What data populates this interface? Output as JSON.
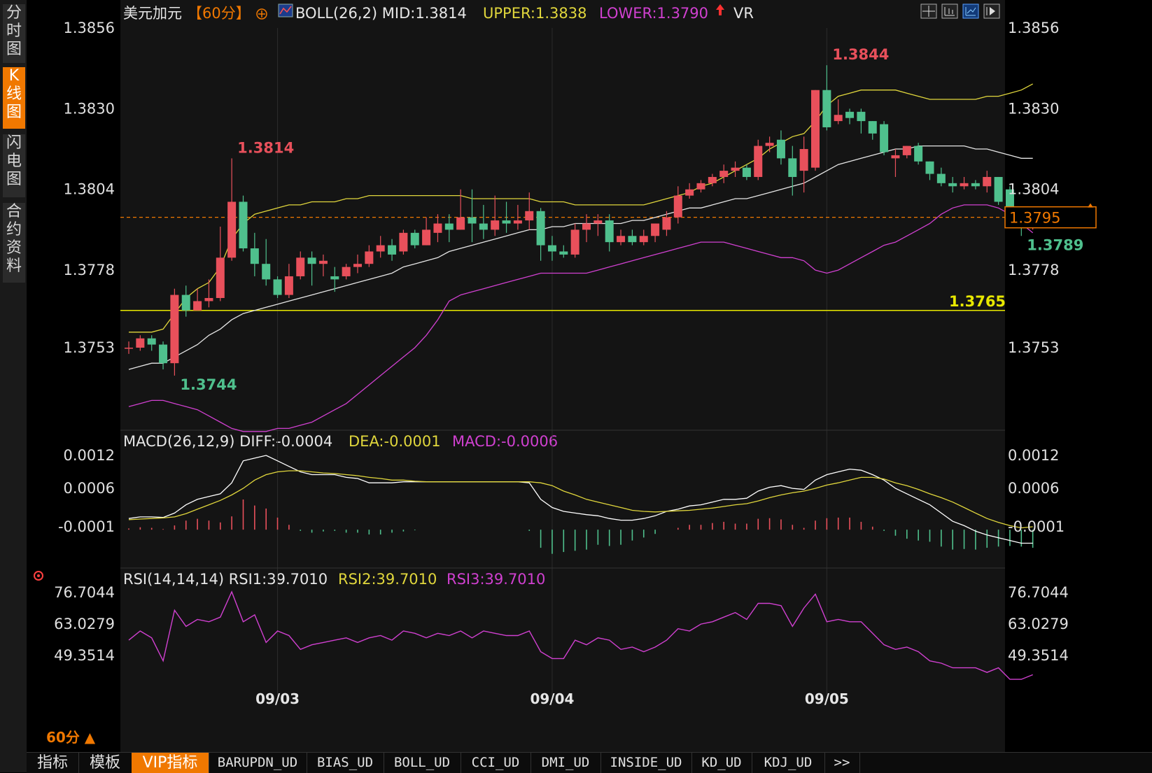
{
  "header": {
    "symbol": "美元加元",
    "period_tag": "【60分】",
    "boll": "BOLL(26,2) MID:1.3814",
    "upper": "UPPER:1.3838",
    "lower": "LOWER:1.3790",
    "vr": "VR"
  },
  "macd_header": {
    "name": "MACD(26,12,9) DIFF:-0.0004",
    "dea": "DEA:-0.0001",
    "macd": "MACD:-0.0006"
  },
  "rsi_header": {
    "name": "RSI(14,14,14) RSI1:39.7010",
    "rsi2": "RSI2:39.7010",
    "rsi3": "RSI3:39.7010"
  },
  "sidebar": [
    {
      "label": "分时图",
      "active": false
    },
    {
      "label": "K线图",
      "active": true
    },
    {
      "label": "闪电图",
      "active": false
    },
    {
      "label": "合约资料",
      "active": false
    }
  ],
  "period_selector": "60分 ▲",
  "bottom_tabs": [
    "指标",
    "模板",
    "VIP指标",
    "BARUPDN_UD",
    "BIAS_UD",
    "BOLL_UD",
    "CCI_UD",
    "DMI_UD",
    "INSIDE_UD",
    "KD_UD",
    "KDJ_UD",
    ">>"
  ],
  "colors": {
    "up": "#e8505b",
    "down": "#4fc08d",
    "mid": "#e6e6e6",
    "upper": "#e0d63c",
    "lower": "#d040d0",
    "price_line": "#f07800",
    "support": "#e8e800"
  },
  "chart_data": [
    {
      "type": "candlestick",
      "title": "美元加元 60分",
      "x_labels": [
        "09/03",
        "09/04",
        "09/05"
      ],
      "x_label_positions": [
        13,
        37,
        61
      ],
      "y_ticks": [
        1.3856,
        1.383,
        1.3804,
        1.3778,
        1.3753
      ],
      "y_tick_labels": [
        "1.3856",
        "1.3830",
        "1.3804",
        "1.3778",
        "1.3753"
      ],
      "ylim": [
        1.373,
        1.386
      ],
      "annotations": [
        {
          "text": "1.3814",
          "x": 9,
          "y": 1.3814,
          "color": "#e8505b"
        },
        {
          "text": "1.3744",
          "x": 4,
          "y": 1.3744,
          "color": "#4fc08d"
        },
        {
          "text": "1.3844",
          "x": 61,
          "y": 1.3844,
          "color": "#e8505b"
        },
        {
          "text": "1.3789",
          "x": 78,
          "y": 1.3789,
          "color": "#4fc08d"
        },
        {
          "text": "1.3765",
          "x": 80,
          "y": 1.3765,
          "color": "#e8e800"
        }
      ],
      "current_price": "1.3795",
      "current_value": 1.3795,
      "support_level": 1.3765,
      "candles": [
        [
          1.3753,
          1.3753,
          1.3755,
          1.3751
        ],
        [
          1.3753,
          1.3756,
          1.3757,
          1.3752
        ],
        [
          1.3756,
          1.3754,
          1.3757,
          1.3752
        ],
        [
          1.3754,
          1.3748,
          1.3755,
          1.3746
        ],
        [
          1.3748,
          1.377,
          1.3772,
          1.3744
        ],
        [
          1.377,
          1.3765,
          1.3773,
          1.3763
        ],
        [
          1.3765,
          1.3768,
          1.3772,
          1.3765
        ],
        [
          1.3768,
          1.3769,
          1.3775,
          1.3766
        ],
        [
          1.3769,
          1.3782,
          1.3792,
          1.3768
        ],
        [
          1.3782,
          1.38,
          1.3814,
          1.3781
        ],
        [
          1.38,
          1.3785,
          1.3802,
          1.3784
        ],
        [
          1.3785,
          1.378,
          1.379,
          1.3776
        ],
        [
          1.378,
          1.3775,
          1.3788,
          1.3773
        ],
        [
          1.3775,
          1.377,
          1.3776,
          1.3769
        ],
        [
          1.377,
          1.3776,
          1.378,
          1.3769
        ],
        [
          1.3776,
          1.3782,
          1.3784,
          1.3775
        ],
        [
          1.3782,
          1.378,
          1.3784,
          1.3773
        ],
        [
          1.378,
          1.3781,
          1.3783,
          1.3776
        ],
        [
          1.3776,
          1.3775,
          1.3779,
          1.3771
        ],
        [
          1.3776,
          1.3779,
          1.378,
          1.3775
        ],
        [
          1.3779,
          1.378,
          1.3783,
          1.3777
        ],
        [
          1.378,
          1.3784,
          1.3786,
          1.3779
        ],
        [
          1.3784,
          1.3786,
          1.3789,
          1.3782
        ],
        [
          1.3786,
          1.3783,
          1.3788,
          1.3781
        ],
        [
          1.3784,
          1.379,
          1.3791,
          1.3783
        ],
        [
          1.379,
          1.3786,
          1.3791,
          1.3785
        ],
        [
          1.3786,
          1.3791,
          1.3795,
          1.3786
        ],
        [
          1.379,
          1.3793,
          1.3796,
          1.3787
        ],
        [
          1.3793,
          1.3791,
          1.3796,
          1.3787
        ],
        [
          1.3791,
          1.3795,
          1.3804,
          1.3791
        ],
        [
          1.3795,
          1.3793,
          1.3804,
          1.3787
        ],
        [
          1.3793,
          1.3791,
          1.3799,
          1.3788
        ],
        [
          1.3791,
          1.3794,
          1.3802,
          1.3789
        ],
        [
          1.3794,
          1.3793,
          1.38,
          1.379
        ],
        [
          1.3793,
          1.3794,
          1.3799,
          1.3791
        ],
        [
          1.3794,
          1.3797,
          1.3803,
          1.3791
        ],
        [
          1.3797,
          1.3786,
          1.3798,
          1.3781
        ],
        [
          1.3786,
          1.3784,
          1.3789,
          1.3781
        ],
        [
          1.3784,
          1.3783,
          1.3786,
          1.3782
        ],
        [
          1.3783,
          1.3791,
          1.3793,
          1.3782
        ],
        [
          1.3791,
          1.3793,
          1.3796,
          1.3787
        ],
        [
          1.3793,
          1.3794,
          1.3796,
          1.3789
        ],
        [
          1.3794,
          1.3787,
          1.3796,
          1.3784
        ],
        [
          1.3787,
          1.3789,
          1.3791,
          1.3786
        ],
        [
          1.3789,
          1.3787,
          1.3791,
          1.3786
        ],
        [
          1.3787,
          1.3789,
          1.3791,
          1.3786
        ],
        [
          1.3789,
          1.3793,
          1.3793,
          1.3787
        ],
        [
          1.3791,
          1.3795,
          1.3797,
          1.3789
        ],
        [
          1.3795,
          1.3802,
          1.3805,
          1.3793
        ],
        [
          1.3802,
          1.3804,
          1.3806,
          1.3801
        ],
        [
          1.3804,
          1.3806,
          1.3807,
          1.3803
        ],
        [
          1.3806,
          1.3808,
          1.3809,
          1.3805
        ],
        [
          1.3808,
          1.381,
          1.3812,
          1.3806
        ],
        [
          1.381,
          1.3811,
          1.3813,
          1.3808
        ],
        [
          1.3811,
          1.3808,
          1.3812,
          1.3807
        ],
        [
          1.3808,
          1.3818,
          1.382,
          1.3807
        ],
        [
          1.3818,
          1.3819,
          1.3821,
          1.3816
        ],
        [
          1.382,
          1.3814,
          1.3823,
          1.3812
        ],
        [
          1.3814,
          1.3808,
          1.3818,
          1.3802
        ],
        [
          1.381,
          1.3817,
          1.3821,
          1.3803
        ],
        [
          1.3811,
          1.3836,
          1.3836,
          1.381
        ],
        [
          1.3836,
          1.3824,
          1.3844,
          1.3823
        ],
        [
          1.3826,
          1.3828,
          1.3833,
          1.3825
        ],
        [
          1.3829,
          1.3827,
          1.383,
          1.3825
        ],
        [
          1.3829,
          1.3826,
          1.383,
          1.3822
        ],
        [
          1.3826,
          1.3822,
          1.3826,
          1.382
        ],
        [
          1.3825,
          1.3816,
          1.3826,
          1.3815
        ],
        [
          1.3814,
          1.3815,
          1.3817,
          1.3808
        ],
        [
          1.3815,
          1.3818,
          1.3818,
          1.3814
        ],
        [
          1.3818,
          1.3813,
          1.3819,
          1.3812
        ],
        [
          1.3813,
          1.3809,
          1.3813,
          1.3807
        ],
        [
          1.3809,
          1.3806,
          1.3811,
          1.3805
        ],
        [
          1.3806,
          1.3805,
          1.3808,
          1.3803
        ],
        [
          1.3805,
          1.3806,
          1.3808,
          1.3804
        ],
        [
          1.3806,
          1.3805,
          1.3807,
          1.3804
        ],
        [
          1.3805,
          1.3808,
          1.381,
          1.3803
        ],
        [
          1.3808,
          1.38,
          1.3808,
          1.3799
        ],
        [
          1.3804,
          1.3795,
          1.3805,
          1.3793
        ],
        [
          1.3794,
          1.3793,
          1.3796,
          1.3789
        ],
        [
          1.3792,
          1.3796,
          1.3797,
          1.3791
        ]
      ],
      "boll_mid": [
        1.3746,
        1.3747,
        1.3748,
        1.3748,
        1.375,
        1.3752,
        1.3754,
        1.3757,
        1.3759,
        1.3762,
        1.3764,
        1.3765,
        1.3766,
        1.3767,
        1.3768,
        1.3769,
        1.377,
        1.3771,
        1.3772,
        1.3773,
        1.3774,
        1.3775,
        1.3776,
        1.3777,
        1.3779,
        1.378,
        1.3781,
        1.3782,
        1.3784,
        1.3785,
        1.3786,
        1.3787,
        1.3788,
        1.3789,
        1.379,
        1.3791,
        1.3791,
        1.3792,
        1.3792,
        1.3793,
        1.3793,
        1.3793,
        1.3793,
        1.3793,
        1.3794,
        1.3794,
        1.3795,
        1.3796,
        1.3797,
        1.3798,
        1.3798,
        1.3799,
        1.38,
        1.3801,
        1.3801,
        1.3802,
        1.3803,
        1.3804,
        1.3805,
        1.3806,
        1.3808,
        1.381,
        1.3812,
        1.3813,
        1.3814,
        1.3815,
        1.3816,
        1.3817,
        1.3817,
        1.3818,
        1.3818,
        1.3818,
        1.3818,
        1.3818,
        1.3817,
        1.3817,
        1.3816,
        1.3815,
        1.3814,
        1.3814
      ],
      "boll_upper": [
        1.3758,
        1.3758,
        1.3758,
        1.3759,
        1.3764,
        1.3769,
        1.3772,
        1.3774,
        1.3779,
        1.3788,
        1.3793,
        1.3796,
        1.3797,
        1.3798,
        1.3799,
        1.3799,
        1.38,
        1.38,
        1.38,
        1.3801,
        1.3801,
        1.3802,
        1.3802,
        1.3802,
        1.3802,
        1.3802,
        1.3802,
        1.3802,
        1.3802,
        1.3802,
        1.3801,
        1.3801,
        1.3801,
        1.3801,
        1.3801,
        1.3801,
        1.38,
        1.38,
        1.38,
        1.3799,
        1.3799,
        1.3799,
        1.3799,
        1.3799,
        1.3799,
        1.3799,
        1.38,
        1.3801,
        1.3802,
        1.3803,
        1.3805,
        1.3806,
        1.3808,
        1.381,
        1.3812,
        1.3814,
        1.3817,
        1.3819,
        1.3821,
        1.3822,
        1.3826,
        1.3831,
        1.3834,
        1.3835,
        1.3836,
        1.3836,
        1.3836,
        1.3836,
        1.3835,
        1.3834,
        1.3833,
        1.3833,
        1.3833,
        1.3833,
        1.3833,
        1.3834,
        1.3834,
        1.3835,
        1.3836,
        1.3838
      ],
      "boll_lower": [
        1.3734,
        1.3735,
        1.3736,
        1.3736,
        1.3735,
        1.3734,
        1.3733,
        1.3731,
        1.3729,
        1.3727,
        1.3726,
        1.3726,
        1.3726,
        1.3727,
        1.3727,
        1.3728,
        1.3729,
        1.3731,
        1.3733,
        1.3735,
        1.3738,
        1.3741,
        1.3744,
        1.3747,
        1.375,
        1.3753,
        1.3757,
        1.3762,
        1.3768,
        1.377,
        1.3771,
        1.3772,
        1.3773,
        1.3774,
        1.3775,
        1.3776,
        1.3777,
        1.3777,
        1.3777,
        1.3777,
        1.3777,
        1.3778,
        1.3779,
        1.378,
        1.3781,
        1.3782,
        1.3783,
        1.3784,
        1.3785,
        1.3786,
        1.3787,
        1.3787,
        1.3787,
        1.3786,
        1.3785,
        1.3784,
        1.3783,
        1.3782,
        1.3782,
        1.3781,
        1.3778,
        1.3777,
        1.3778,
        1.378,
        1.3782,
        1.3784,
        1.3786,
        1.3787,
        1.3789,
        1.3791,
        1.3793,
        1.3796,
        1.3798,
        1.3799,
        1.3799,
        1.3799,
        1.3798,
        1.3796,
        1.3793,
        1.379
      ]
    },
    {
      "type": "line",
      "title": "MACD(26,12,9)",
      "y_ticks": [
        0.0012,
        0.0006,
        -0.0001
      ],
      "y_tick_labels": [
        "0.0012",
        "0.0006",
        "-0.0001"
      ],
      "ylim": [
        -0.0007,
        0.0013
      ],
      "diff": [
        5e-05,
        8e-05,
        8e-05,
        7e-05,
        0.00015,
        0.0003,
        0.0004,
        0.00045,
        0.0005,
        0.0007,
        0.0011,
        0.00115,
        0.0012,
        0.0011,
        0.001,
        0.0009,
        0.00085,
        0.00085,
        0.00085,
        0.0008,
        0.00078,
        0.0007,
        0.0007,
        0.0007,
        0.00072,
        0.00072,
        0.00072,
        0.00072,
        0.00072,
        0.00072,
        0.00072,
        0.00072,
        0.00072,
        0.00072,
        0.00072,
        0.0007,
        0.0004,
        0.00025,
        0.00018,
        0.00015,
        0.00012,
        0.0001,
        5e-05,
        2e-05,
        2e-05,
        5e-05,
        0.0001,
        0.00018,
        0.00022,
        0.00028,
        0.0003,
        0.00035,
        0.0004,
        0.0004,
        0.00042,
        0.00055,
        0.00062,
        0.00065,
        0.0006,
        0.00058,
        0.00075,
        0.00085,
        0.0009,
        0.00095,
        0.00093,
        0.00085,
        0.00075,
        0.0006,
        0.0005,
        0.0004,
        0.0003,
        0.00015,
        0.0,
        -8e-05,
        -0.00018,
        -0.00025,
        -0.0003,
        -0.00035,
        -0.0004,
        -0.0004
      ],
      "dea": [
        3e-05,
        4e-05,
        5e-05,
        6e-05,
        8e-05,
        0.00014,
        0.00022,
        0.0003,
        0.00038,
        0.00048,
        0.0006,
        0.00075,
        0.00085,
        0.0009,
        0.00092,
        0.00092,
        0.0009,
        0.00088,
        0.00087,
        0.00085,
        0.00083,
        0.0008,
        0.00078,
        0.00075,
        0.00075,
        0.00073,
        0.00072,
        0.00072,
        0.00072,
        0.00072,
        0.00072,
        0.00072,
        0.00072,
        0.00072,
        0.00072,
        0.00072,
        0.0007,
        0.00065,
        0.00055,
        0.00048,
        0.0004,
        0.00035,
        0.0003,
        0.00025,
        0.0002,
        0.00018,
        0.00017,
        0.00018,
        0.00019,
        0.0002,
        0.00022,
        0.00024,
        0.00027,
        0.0003,
        0.00032,
        0.00037,
        0.00043,
        0.00048,
        0.00052,
        0.00055,
        0.0006,
        0.00066,
        0.0007,
        0.00075,
        0.0008,
        0.0008,
        0.00077,
        0.0007,
        0.00065,
        0.00058,
        0.0005,
        0.00043,
        0.00035,
        0.00025,
        0.00015,
        5e-05,
        -2e-05,
        -8e-05,
        -0.00012,
        -0.0001
      ],
      "hist": [
        4e-05,
        8e-05,
        6e-05,
        2e-05,
        0.00014,
        0.0003,
        0.00036,
        0.0003,
        0.00024,
        0.00044,
        0.001,
        0.0008,
        0.0007,
        0.0004,
        0.00016,
        -4e-05,
        -0.0001,
        -6e-05,
        -4e-05,
        -0.0001,
        -0.0001,
        -0.00016,
        -0.00016,
        -0.0001,
        -6e-05,
        -2e-05,
        0.0,
        0.0,
        0.0,
        0.0,
        0.0,
        0.0,
        0.0,
        0.0,
        0.0,
        -4e-05,
        -0.0006,
        -0.0008,
        -0.00074,
        -0.0007,
        -0.00066,
        -0.0005,
        -0.00054,
        -0.0005,
        -0.00036,
        -0.00026,
        -0.00014,
        0.0,
        6e-05,
        0.00016,
        0.00016,
        0.00022,
        0.00026,
        0.0002,
        0.0002,
        0.00036,
        0.00038,
        0.00034,
        0.00016,
        6e-05,
        0.0003,
        0.00038,
        0.0004,
        0.0004,
        0.00026,
        0.0001,
        -4e-05,
        -0.0002,
        -0.0003,
        -0.00036,
        -0.0004,
        -0.00056,
        -0.00066,
        -0.00064,
        -0.00066,
        -0.0006,
        -0.00056,
        -0.00054,
        -0.00056,
        -0.0006
      ]
    },
    {
      "type": "line",
      "title": "RSI(14,14,14)",
      "y_ticks": [
        76.7044,
        63.0279,
        49.3514
      ],
      "y_tick_labels": [
        "76.7044",
        "63.0279",
        "49.3514"
      ],
      "ylim": [
        36.0,
        80.0
      ],
      "rsi": [
        56,
        60,
        57,
        47,
        69,
        62,
        65,
        64,
        66,
        77,
        64,
        67,
        55,
        60,
        58,
        52,
        54,
        55,
        56,
        57,
        55,
        57,
        58,
        56,
        60,
        59,
        57,
        59,
        58,
        60,
        57,
        60,
        59,
        58,
        58,
        60,
        51,
        48,
        48,
        56,
        54,
        57,
        56,
        52,
        53,
        51,
        53,
        56,
        61,
        60,
        63,
        64,
        66,
        68,
        65,
        72,
        72,
        71,
        62,
        70,
        76,
        64,
        65,
        64,
        64,
        59,
        54,
        52,
        53,
        51,
        47,
        46,
        44,
        44,
        44,
        42,
        44,
        39,
        39,
        41
      ]
    }
  ]
}
